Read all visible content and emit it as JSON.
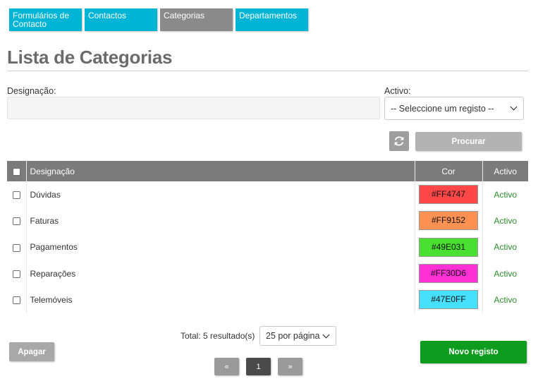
{
  "tabs": [
    {
      "label": "Formulários de Contacto",
      "active": false
    },
    {
      "label": "Contactos",
      "active": false
    },
    {
      "label": "Categorias",
      "active": true
    },
    {
      "label": "Departamentos",
      "active": false
    }
  ],
  "page_title": "Lista de Categorias",
  "filters": {
    "designacao_label": "Designação:",
    "designacao_value": "",
    "activo_label": "Activo:",
    "activo_selected": "-- Seleccione um registo --"
  },
  "buttons": {
    "refresh_icon": "refresh-icon",
    "search": "Procurar",
    "delete": "Apagar",
    "new": "Novo registo"
  },
  "table": {
    "headers": {
      "designacao": "Designação",
      "cor": "Cor",
      "activo": "Activo"
    },
    "rows": [
      {
        "name": "Dúvidas",
        "color": "#FF4747",
        "status": "Activo"
      },
      {
        "name": "Faturas",
        "color": "#FF9152",
        "status": "Activo"
      },
      {
        "name": "Pagamentos",
        "color": "#49E031",
        "status": "Activo"
      },
      {
        "name": "Reparações",
        "color": "#FF30D6",
        "status": "Activo"
      },
      {
        "name": "Telemóveis",
        "color": "#47E0FF",
        "status": "Activo"
      }
    ]
  },
  "footer": {
    "total": "Total: 5 resultado(s)",
    "per_page": "25 por página"
  },
  "pagination": {
    "prev": "«",
    "current": "1",
    "next": "»"
  },
  "colors": {
    "tab": "#00b4d6",
    "tab_active": "#8a8a8a",
    "header": "#7b7b7b",
    "status_active": "#2c8a2c",
    "new_button": "#0e9c1f"
  }
}
